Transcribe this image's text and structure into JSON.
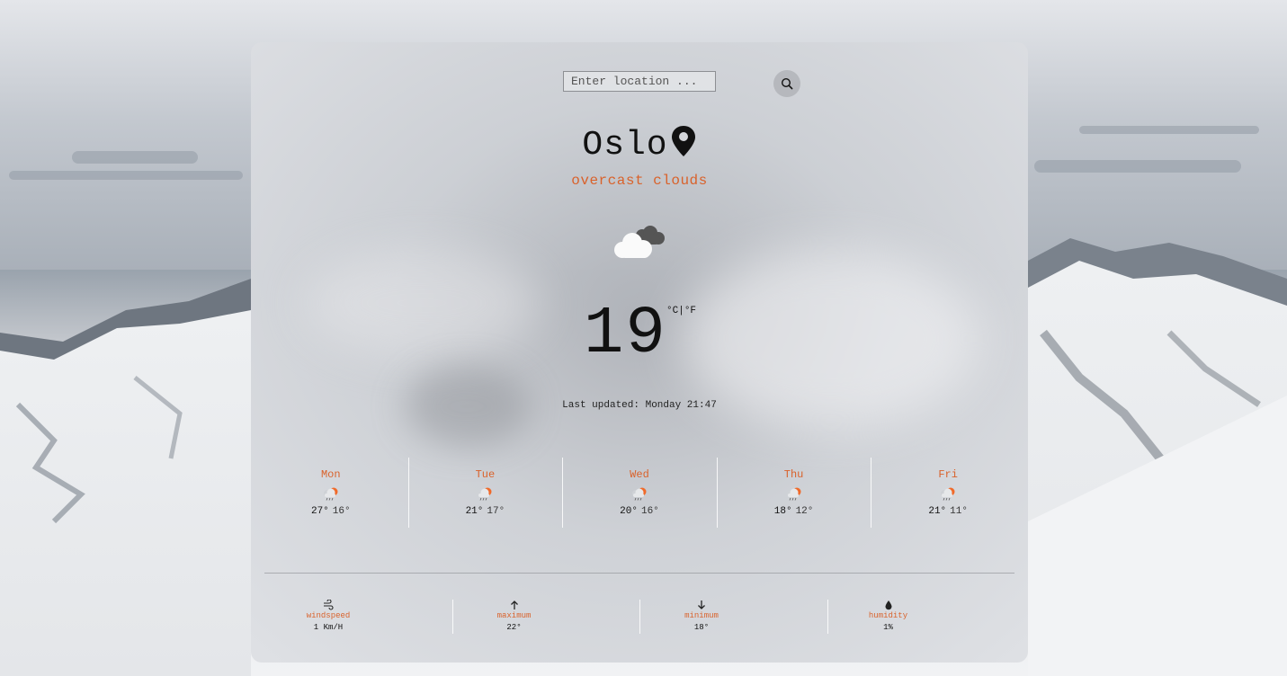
{
  "search": {
    "placeholder": "Enter location ..."
  },
  "location": {
    "city": "Oslo",
    "description": "overcast clouds"
  },
  "current": {
    "temperature": "19",
    "unit_c": "°C",
    "separator": "|",
    "unit_f": "°F"
  },
  "last_updated": "Last updated: Monday 21:47",
  "forecast": [
    {
      "day": "Mon",
      "high": "27°",
      "low": "16°"
    },
    {
      "day": "Tue",
      "high": "21°",
      "low": "17°"
    },
    {
      "day": "Wed",
      "high": "20°",
      "low": "16°"
    },
    {
      "day": "Thu",
      "high": "18°",
      "low": "12°"
    },
    {
      "day": "Fri",
      "high": "21°",
      "low": "11°"
    }
  ],
  "stats": {
    "windspeed": {
      "label": "windspeed",
      "value": "1 Km/H"
    },
    "maximum": {
      "label": "maximum",
      "value": "22°"
    },
    "minimum": {
      "label": "minimum",
      "value": "18°"
    },
    "humidity": {
      "label": "humidity",
      "value": "1%"
    }
  },
  "colors": {
    "accent": "#d9622b",
    "text": "#111111"
  },
  "icons": {
    "search": "search-icon",
    "pin": "map-pin-icon",
    "current": "overcast-clouds-icon",
    "forecast": "cloud-sun-rain-icon",
    "windspeed": "wind-icon",
    "maximum": "arrow-up-icon",
    "minimum": "arrow-down-icon",
    "humidity": "droplet-icon"
  }
}
